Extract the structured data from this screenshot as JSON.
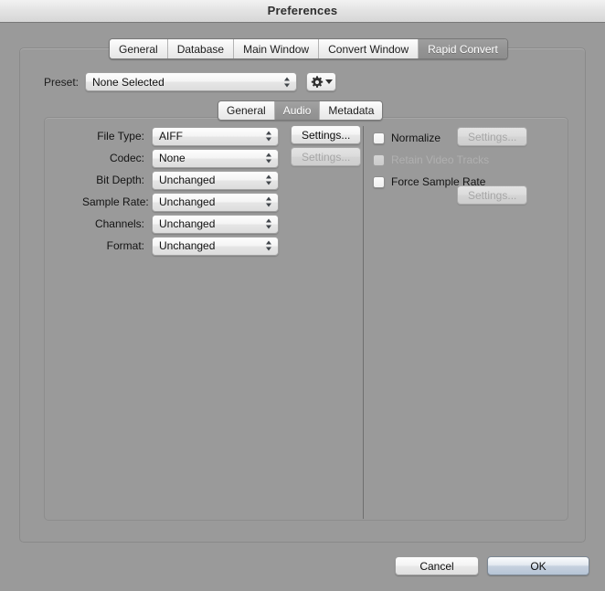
{
  "window": {
    "title": "Preferences"
  },
  "top_tabs": [
    {
      "label": "General",
      "selected": false
    },
    {
      "label": "Database",
      "selected": false
    },
    {
      "label": "Main Window",
      "selected": false
    },
    {
      "label": "Convert Window",
      "selected": false
    },
    {
      "label": "Rapid Convert",
      "selected": true
    }
  ],
  "preset": {
    "label": "Preset:",
    "value": "None Selected",
    "gear_icon": "gear-icon",
    "gear_menu_arrow": "chevron-down-icon"
  },
  "inner_tabs": [
    {
      "label": "General",
      "selected": false
    },
    {
      "label": "Audio",
      "selected": true
    },
    {
      "label": "Metadata",
      "selected": false
    }
  ],
  "audio_panel": {
    "rows": [
      {
        "label": "File Type:",
        "value": "AIFF"
      },
      {
        "label": "Codec:",
        "value": "None"
      },
      {
        "label": "Bit Depth:",
        "value": "Unchanged"
      },
      {
        "label": "Sample Rate:",
        "value": "Unchanged"
      },
      {
        "label": "Channels:",
        "value": "Unchanged"
      },
      {
        "label": "Format:",
        "value": "Unchanged"
      }
    ],
    "settings_filetype": {
      "label": "Settings...",
      "enabled": true
    },
    "settings_codec": {
      "label": "Settings...",
      "enabled": false
    },
    "checkboxes": [
      {
        "label": "Normalize",
        "checked": false,
        "enabled": true
      },
      {
        "label": "Retain Video Tracks",
        "checked": false,
        "enabled": false
      },
      {
        "label": "Force Sample Rate",
        "checked": false,
        "enabled": true
      }
    ],
    "settings_normalize": {
      "label": "Settings...",
      "enabled": false
    },
    "settings_force_sample_rate": {
      "label": "Settings...",
      "enabled": false
    }
  },
  "footer": {
    "cancel_label": "Cancel",
    "ok_label": "OK"
  },
  "colors": {
    "window_background": "#9a9a9a",
    "titlebar_top": "#f2f2f2",
    "titlebar_bottom": "#d6d6d6",
    "selected_tab_background": "#949494",
    "selected_tab_text": "#ffffff",
    "default_button_accent": "#c6d1df",
    "disabled_text": "#b0b0b0"
  }
}
